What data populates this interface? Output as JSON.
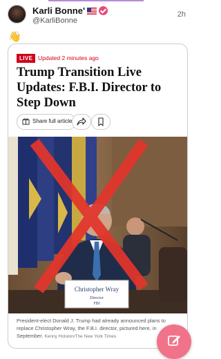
{
  "post": {
    "author_name": "Karli Bonne'",
    "handle": "@KarliBonne",
    "time": "2h",
    "emoji": "👋"
  },
  "article": {
    "live_label": "LIVE",
    "updated": "Updated 2 minutes ago",
    "headline": "Trump Transition Live Updates: F.B.I. Director to Step Down",
    "share_label": "Share full article",
    "caption": "President-elect Donald J. Trump had already announced plans to replace Christopher Wray, the F.B.I. director, pictured here, in September.",
    "credit": "Kenny Holston/The New York Times",
    "nameplate_name": "Christopher Wray",
    "nameplate_title": "Director",
    "nameplate_org": "FBI"
  },
  "colors": {
    "accent_red": "#d0021b",
    "x_mark": "#e3352b",
    "fab": "#f07389"
  },
  "icons": [
    "flag-us-icon",
    "verified-badge-icon",
    "share-gift-icon",
    "forward-icon",
    "bookmark-icon",
    "compose-icon"
  ]
}
